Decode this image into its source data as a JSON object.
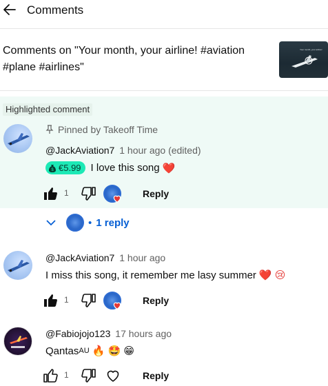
{
  "header": {
    "title": "Comments",
    "back_icon": "arrow-left-icon"
  },
  "video_ref": {
    "text": "Comments on \"Your month, your airline! #aviation #plane #airlines\"",
    "thumb_caption": "Your month, your airline!"
  },
  "highlight": {
    "label": "Highlighted comment",
    "bg_color": "#effaf6"
  },
  "comments": [
    {
      "pinned_text": "Pinned by Takeoff Time",
      "author": "@JackAviation7",
      "meta": "1 hour ago (edited)",
      "thanks_amount": "€5.99",
      "text": "I love this song",
      "emoji": "❤️",
      "like_count": "1",
      "reply_label": "Reply",
      "replies_label": "1 reply"
    },
    {
      "author": "@JackAviation7",
      "meta": "1 hour ago",
      "text": "I miss this song, it remember me lasy summer",
      "emoji": "❤️ 😢",
      "like_count": "1",
      "reply_label": "Reply"
    },
    {
      "author": "@Fabiojojo123",
      "meta": "17 hours ago",
      "text": "Qantas",
      "text_suffix": "AU",
      "emoji": "🔥 🤩 😁",
      "like_count": "1",
      "reply_label": "Reply"
    }
  ],
  "colors": {
    "accent_link": "#065fd4",
    "thanks_badge": "#1de9b6",
    "heart": "#e53935"
  }
}
